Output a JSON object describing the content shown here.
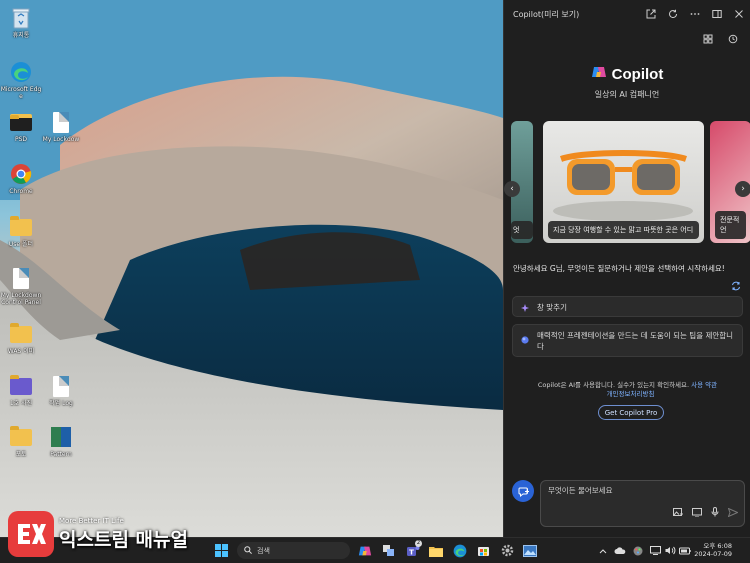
{
  "desktop": {
    "icons": [
      {
        "label": "휴지통",
        "icon": "recycle-bin-icon"
      },
      {
        "label": "Microsoft Edge",
        "icon": "edge-icon"
      },
      {
        "label": "PSD",
        "icon": "folder-icon"
      },
      {
        "label": "My Lockdow",
        "icon": "document-icon"
      },
      {
        "label": "Chrome",
        "icon": "chrome-icon"
      },
      {
        "label": "Use 폴더",
        "icon": "folder-icon"
      },
      {
        "label": "My Lockdown Control Panel",
        "icon": "document-icon"
      },
      {
        "label": "WAS 이미",
        "icon": "folder-icon"
      },
      {
        "label": "1호 사진",
        "icon": "folder-icon"
      },
      {
        "label": "작업 Log",
        "icon": "document-icon"
      },
      {
        "label": "포토",
        "icon": "folder-icon"
      },
      {
        "label": "Pattern",
        "icon": "app-icon"
      }
    ]
  },
  "copilot": {
    "window_title": "Copilot(미리 보기)",
    "brand": "Copilot",
    "tagline": "일상의 AI 컴패니언",
    "cards": [
      {
        "caption": "엇"
      },
      {
        "caption": "지금 당장 여행할 수 있는 맑고 따뜻한 곳은 어디"
      },
      {
        "caption": "전문적 언"
      }
    ],
    "greeting": "안녕하세요 G님, 무엇이든 질문하거나 제안을 선택하여 시작하세요!",
    "suggestions": [
      {
        "text": "창 맞추기",
        "icon": "sparkle-icon"
      },
      {
        "text": "매력적인 프레젠테이션을 만드는 데 도움이 되는 팁을 제안합니다",
        "icon": "copilot-orb-icon"
      }
    ],
    "disclaimer_text": "Copilot은 AI를 사용합니다. 실수가 있는지 확인하세요.",
    "terms_link": "사용 약관",
    "privacy_link": "개인정보처리방침",
    "pro_button": "Get Copilot Pro",
    "composer_placeholder": "무엇이든 물어보세요"
  },
  "taskbar": {
    "search_placeholder": "검색",
    "teams_badge": "2",
    "time": "오후 6:08",
    "date": "2024-07-09"
  },
  "watermark": {
    "small": "More Better IT Life",
    "big": "익스트림 매뉴얼"
  },
  "colors": {
    "panel_bg": "#1f1f1f",
    "accent_blue": "#2a63d6",
    "link": "#7fb3ff",
    "taskbar_bg": "#202020"
  }
}
